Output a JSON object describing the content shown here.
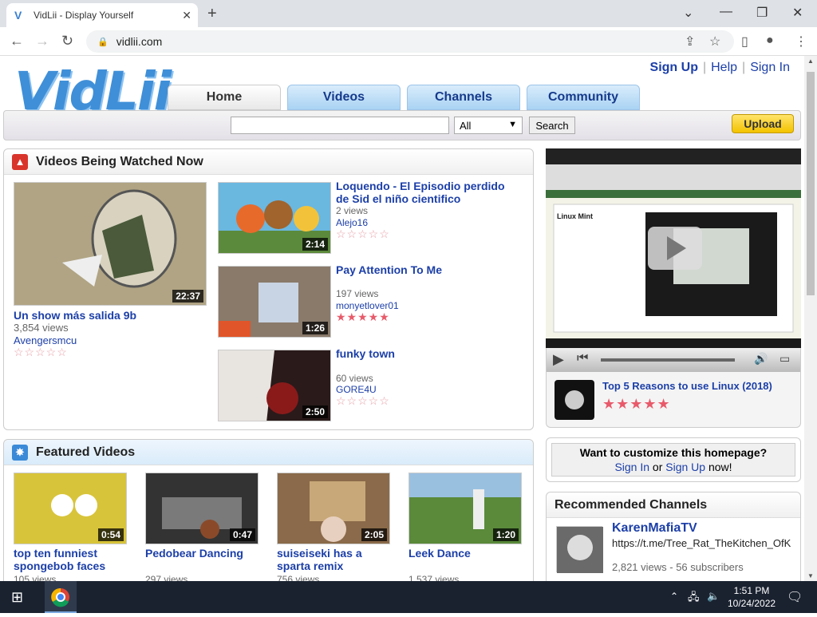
{
  "browser": {
    "tab_title": "VidLii - Display Yourself",
    "url": "vidlii.com"
  },
  "site": {
    "logo": "VidLii",
    "links": [
      "Sign Up",
      "Help",
      "Sign In"
    ],
    "nav_tabs": [
      "Home",
      "Videos",
      "Channels",
      "Community"
    ],
    "search": {
      "select": "All",
      "button": "Search",
      "upload": "Upload"
    }
  },
  "watched": {
    "title": "Videos Being Watched Now",
    "main": {
      "title": "Un show más salida 9b",
      "views": "3,854 views",
      "user": "Avengersmcu",
      "duration": "22:37"
    },
    "list": [
      {
        "title": "Loquendo - El Episodio perdido de Sid el niño cientifico",
        "views": "2 views",
        "user": "Alejo16",
        "duration": "2:14",
        "rated": false
      },
      {
        "title": "Pay Attention To Me",
        "views": "197 views",
        "user": "monyetlover01",
        "duration": "1:26",
        "rated": true
      },
      {
        "title": "funky town",
        "views": "60 views",
        "user": "GORE4U",
        "duration": "2:50",
        "rated": false
      }
    ]
  },
  "featured": {
    "title": "Featured Videos",
    "items": [
      {
        "title": "top ten funniest spongebob faces",
        "views": "105 views",
        "duration": "0:54"
      },
      {
        "title": "Pedobear Dancing",
        "views": "297 views",
        "duration": "0:47"
      },
      {
        "title": "suiseiseki has a sparta remix",
        "views": "756 views",
        "duration": "2:05"
      },
      {
        "title": "Leek Dance",
        "views": "1,537 views",
        "duration": "1:20"
      }
    ]
  },
  "player": {
    "video_title": "Top 5 Reasons to use Linux (2018)",
    "screen_heading": "Linux Mint"
  },
  "customize": {
    "line1": "Want to customize this homepage?",
    "sign_in": "Sign In",
    "or": "or",
    "sign_up": "Sign Up",
    "now": "now!"
  },
  "recommended": {
    "title": "Recommended Channels",
    "channel": {
      "name": "KarenMafiaTV",
      "desc": "https://t.me/Tree_Rat_TheKitchen_OfK",
      "stats": "2,821 views - 56 subscribers"
    }
  },
  "taskbar": {
    "time": "1:51 PM",
    "date": "10/24/2022"
  }
}
